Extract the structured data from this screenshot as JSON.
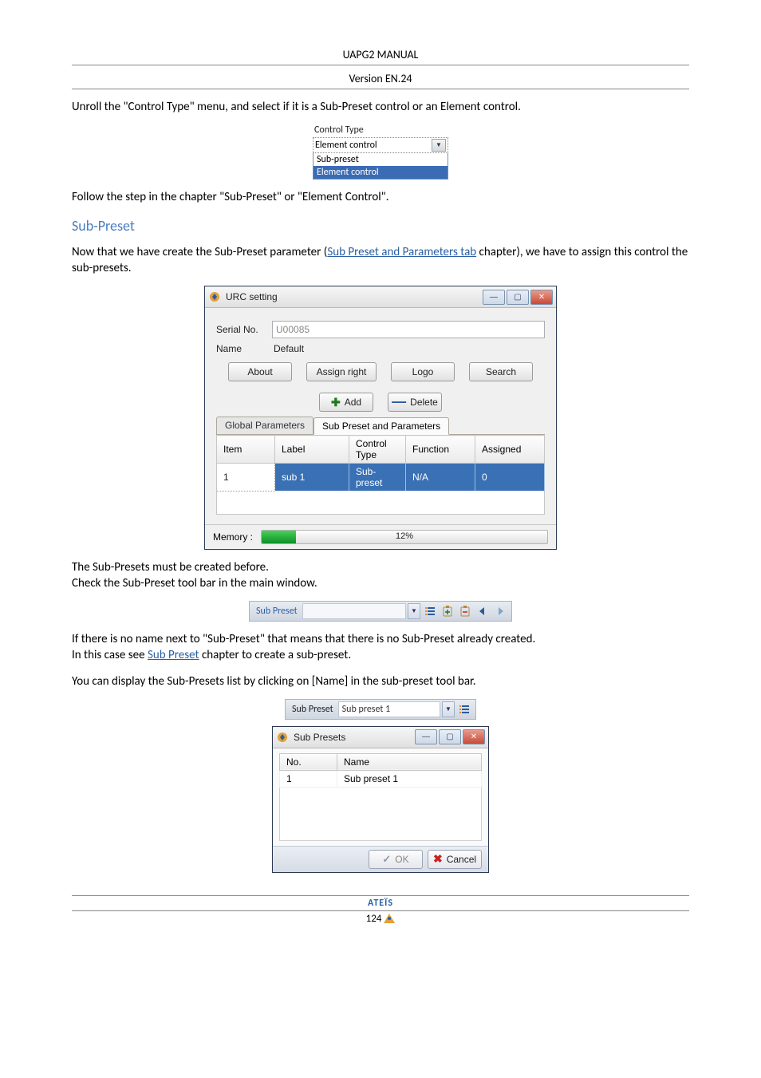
{
  "header": {
    "title": "UAPG2  MANUAL",
    "subtitle": "Version EN.24"
  },
  "paragraphs": {
    "p1": "Unroll the \"Control Type\" menu, and select if it is a Sub-Preset control or an Element control.",
    "p2": "Follow the step in the chapter \"Sub-Preset\" or \"Element Control\".",
    "sub_preset_heading": "Sub-Preset",
    "p3_pre": "Now that we have create the Sub-Preset parameter (",
    "p3_link": "Sub Preset and Parameters tab",
    "p3_post": " chapter), we have to assign this control the sub-presets.",
    "p4": "The Sub-Presets must be created before.",
    "p5": "Check the Sub-Preset tool bar in the main window.",
    "p6_pre": "If there is no name next to \"Sub-Preset\" that means that there is no Sub-Preset already created.\nIn this case see ",
    "p6_link": "Sub Preset",
    "p6_post": " chapter to create a sub-preset.",
    "p7": "You can display the Sub-Presets list by clicking on [Name] in the sub-preset tool bar."
  },
  "control_type_combo": {
    "label": "Control Type",
    "selected": "Element control",
    "options": [
      "Sub-preset",
      "Element control"
    ]
  },
  "urc_dialog": {
    "title": "URC setting",
    "fields": {
      "serial_label": "Serial No.",
      "serial_value": "U00085",
      "name_label": "Name",
      "name_value": "Default"
    },
    "buttons": {
      "about": "About",
      "assign_right": "Assign right",
      "logo": "Logo",
      "search": "Search",
      "add": "Add",
      "delete": "Delete"
    },
    "tabs": {
      "global": "Global Parameters",
      "subp": "Sub Preset and Parameters"
    },
    "table": {
      "headers": [
        "Item",
        "Label",
        "Control Type",
        "Function",
        "Assigned"
      ],
      "row": {
        "item": "1",
        "label": "sub 1",
        "control_type": "Sub-preset",
        "function": "N/A",
        "assigned": "0"
      }
    },
    "memory": {
      "label": "Memory :",
      "percent": 12,
      "text": "12%"
    }
  },
  "toolbar_strip": {
    "label": "Sub Preset",
    "name": ""
  },
  "toolbar_strip2": {
    "label": "Sub Preset",
    "name": "Sub preset 1"
  },
  "subp_dialog": {
    "title": "Sub Presets",
    "headers": {
      "no": "No.",
      "name": "Name"
    },
    "row": {
      "no": "1",
      "name": "Sub preset 1"
    },
    "ok": "OK",
    "cancel": "Cancel"
  },
  "footer": {
    "brand": "ATEÏS",
    "page": "124"
  }
}
